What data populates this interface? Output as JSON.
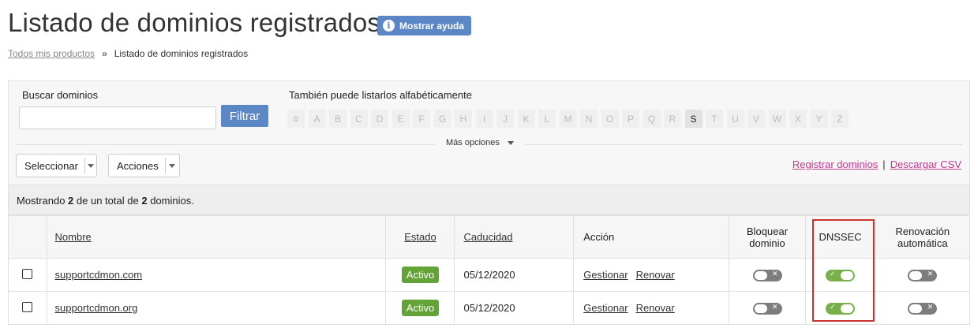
{
  "page": {
    "title": "Listado de dominios registrados",
    "help_label": "Mostrar ayuda",
    "help_icon": "info-icon"
  },
  "breadcrumb": {
    "parent": "Todos mis productos",
    "separator": "»",
    "current": "Listado de dominios registrados"
  },
  "search": {
    "label": "Buscar dominios",
    "value": "",
    "placeholder": "",
    "filter_label": "Filtrar"
  },
  "alphabet": {
    "label": "También puede listarlos alfabéticamente",
    "letters": [
      "#",
      "A",
      "B",
      "C",
      "D",
      "E",
      "F",
      "G",
      "H",
      "I",
      "J",
      "K",
      "L",
      "M",
      "N",
      "O",
      "P",
      "Q",
      "R",
      "S",
      "T",
      "U",
      "V",
      "W",
      "X",
      "Y",
      "Z"
    ],
    "selected": "S"
  },
  "more_options": "Más opciones",
  "toolbar": {
    "select_label": "Seleccionar",
    "actions_label": "Acciones",
    "register_link": "Registrar dominios",
    "link_separator": "|",
    "csv_link": "Descargar CSV"
  },
  "summary": {
    "prefix": "Mostrando",
    "shown": "2",
    "middle": "de un total de",
    "total": "2",
    "suffix": "dominios."
  },
  "table": {
    "headers": {
      "name": "Nombre",
      "estado": "Estado",
      "caducidad": "Caducidad",
      "accion": "Acción",
      "bloquear": "Bloquear dominio",
      "dnssec": "DNSSEC",
      "renovacion": "Renovación automática"
    },
    "rows": [
      {
        "domain": "supportcdmon.com",
        "status": "Activo",
        "expiry": "05/12/2020",
        "manage": "Gestionar",
        "renew": "Renovar",
        "lock": false,
        "dnssec": true,
        "autorenew": false
      },
      {
        "domain": "supportcdmon.org",
        "status": "Activo",
        "expiry": "05/12/2020",
        "manage": "Gestionar",
        "renew": "Renovar",
        "lock": false,
        "dnssec": true,
        "autorenew": false
      }
    ]
  },
  "colors": {
    "primary": "#5b87c7",
    "link_accent": "#c23a8e",
    "status_active": "#64a337",
    "toggle_on": "#78b04b",
    "toggle_off": "#7d7d7d",
    "highlight": "#c8332d"
  }
}
